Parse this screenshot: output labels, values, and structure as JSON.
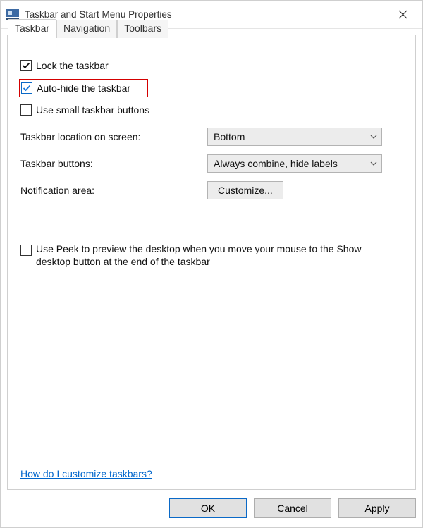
{
  "window": {
    "title": "Taskbar and Start Menu Properties"
  },
  "tabs": {
    "taskbar": "Taskbar",
    "navigation": "Navigation",
    "toolbars": "Toolbars"
  },
  "options": {
    "lock": "Lock the taskbar",
    "autohide": "Auto-hide the taskbar",
    "small": "Use small taskbar buttons",
    "location_label": "Taskbar location on screen:",
    "location_value": "Bottom",
    "buttons_label": "Taskbar buttons:",
    "buttons_value": "Always combine, hide labels",
    "notif_label": "Notification area:",
    "notif_button": "Customize...",
    "peek": "Use Peek to preview the desktop when you move your mouse to the Show desktop button at the end of the taskbar"
  },
  "help_link": "How do I customize taskbars?",
  "footer": {
    "ok": "OK",
    "cancel": "Cancel",
    "apply": "Apply"
  }
}
